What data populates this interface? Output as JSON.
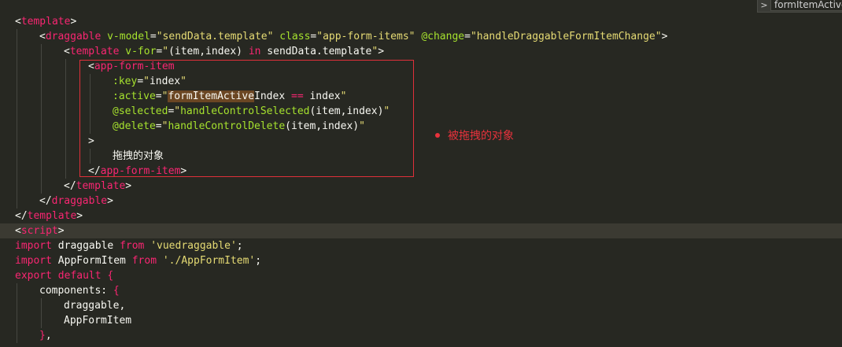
{
  "editor": {
    "theme_colors": {
      "background": "#272822",
      "tag": "#f92672",
      "attribute": "#a6e22e",
      "string": "#e6db74",
      "text": "#f8f8f2",
      "highlight_box": "#e0303a"
    },
    "lines": [
      {
        "indent": 0,
        "tokens": [
          [
            "t-punc",
            "<"
          ],
          [
            "t-tag",
            "template"
          ],
          [
            "t-punc",
            ">"
          ]
        ]
      },
      {
        "indent": 1,
        "tokens": [
          [
            "t-punc",
            "<"
          ],
          [
            "t-tag",
            "draggable"
          ],
          [
            "t-punc",
            " "
          ],
          [
            "t-attr",
            "v-model"
          ],
          [
            "t-punc",
            "="
          ],
          [
            "t-str",
            "\"sendData.template\""
          ],
          [
            "t-punc",
            " "
          ],
          [
            "t-attr",
            "class"
          ],
          [
            "t-punc",
            "="
          ],
          [
            "t-str",
            "\"app-form-items\""
          ],
          [
            "t-punc",
            " "
          ],
          [
            "t-attr",
            "@change"
          ],
          [
            "t-punc",
            "="
          ],
          [
            "t-str",
            "\"handleDraggableFormItemChange\""
          ],
          [
            "t-punc",
            ">"
          ]
        ]
      },
      {
        "indent": 2,
        "tokens": [
          [
            "t-punc",
            "<"
          ],
          [
            "t-tag",
            "template"
          ],
          [
            "t-punc",
            " "
          ],
          [
            "t-attr",
            "v-for"
          ],
          [
            "t-punc",
            "="
          ],
          [
            "t-str",
            "\""
          ],
          [
            "t-name",
            "(item,index) "
          ],
          [
            "t-kw",
            "in"
          ],
          [
            "t-name",
            " sendData.template"
          ],
          [
            "t-str",
            "\""
          ],
          [
            "t-punc",
            ">"
          ]
        ]
      },
      {
        "indent": 3,
        "tokens": [
          [
            "t-punc",
            "<"
          ],
          [
            "t-tag",
            "app-form-item"
          ]
        ]
      },
      {
        "indent": 4,
        "tokens": [
          [
            "t-attr",
            ":key"
          ],
          [
            "t-punc",
            "="
          ],
          [
            "t-str",
            "\""
          ],
          [
            "t-name",
            "index"
          ],
          [
            "t-str",
            "\""
          ]
        ]
      },
      {
        "indent": 4,
        "tokens": [
          [
            "t-attr",
            ":active"
          ],
          [
            "t-punc",
            "="
          ],
          [
            "t-str",
            "\""
          ],
          [
            "t-match",
            "formItemActive"
          ],
          [
            "t-name",
            "Index "
          ],
          [
            "t-op",
            "=="
          ],
          [
            "t-name",
            " index"
          ],
          [
            "t-str",
            "\""
          ]
        ]
      },
      {
        "indent": 4,
        "tokens": [
          [
            "t-attr",
            "@selected"
          ],
          [
            "t-punc",
            "="
          ],
          [
            "t-str",
            "\""
          ],
          [
            "t-attr",
            "handleControlSelected"
          ],
          [
            "t-name",
            "(item,index)"
          ],
          [
            "t-str",
            "\""
          ]
        ]
      },
      {
        "indent": 4,
        "tokens": [
          [
            "t-attr",
            "@delete"
          ],
          [
            "t-punc",
            "="
          ],
          [
            "t-str",
            "\""
          ],
          [
            "t-attr",
            "handleControlDelete"
          ],
          [
            "t-name",
            "(item,index)"
          ],
          [
            "t-str",
            "\""
          ]
        ]
      },
      {
        "indent": 3,
        "tokens": [
          [
            "t-punc",
            ">"
          ]
        ]
      },
      {
        "indent": 4,
        "tokens": [
          [
            "t-text",
            "拖拽的对象"
          ]
        ]
      },
      {
        "indent": 3,
        "tokens": [
          [
            "t-punc",
            "</"
          ],
          [
            "t-tag",
            "app-form-item"
          ],
          [
            "t-punc",
            ">"
          ]
        ]
      },
      {
        "indent": 2,
        "tokens": [
          [
            "t-punc",
            "</"
          ],
          [
            "t-tag",
            "template"
          ],
          [
            "t-punc",
            ">"
          ]
        ]
      },
      {
        "indent": 1,
        "tokens": [
          [
            "t-punc",
            "</"
          ],
          [
            "t-tag",
            "draggable"
          ],
          [
            "t-punc",
            ">"
          ]
        ]
      },
      {
        "indent": 0,
        "tokens": [
          [
            "t-punc",
            "</"
          ],
          [
            "t-tag",
            "template"
          ],
          [
            "t-punc",
            ">"
          ]
        ]
      },
      {
        "indent": 0,
        "highlight": true,
        "tokens": [
          [
            "t-punc",
            "<"
          ],
          [
            "t-tag",
            "script"
          ],
          [
            "t-punc",
            ">"
          ]
        ]
      },
      {
        "indent": 0,
        "tokens": [
          [
            "t-kw",
            "import"
          ],
          [
            "t-name",
            " draggable "
          ],
          [
            "t-kw",
            "from"
          ],
          [
            "t-name",
            " "
          ],
          [
            "t-str",
            "'vuedraggable'"
          ],
          [
            "t-name",
            ";"
          ]
        ]
      },
      {
        "indent": 0,
        "tokens": [
          [
            "t-kw",
            "import"
          ],
          [
            "t-name",
            " AppFormItem "
          ],
          [
            "t-kw",
            "from"
          ],
          [
            "t-name",
            " "
          ],
          [
            "t-str",
            "'./AppFormItem'"
          ],
          [
            "t-name",
            ";"
          ]
        ]
      },
      {
        "indent": 0,
        "tokens": [
          [
            "t-kw",
            "export"
          ],
          [
            "t-name",
            " "
          ],
          [
            "t-kw",
            "default"
          ],
          [
            "t-name",
            " "
          ],
          [
            "t-brace",
            "{"
          ]
        ]
      },
      {
        "indent": 1,
        "tokens": [
          [
            "t-name",
            "components: "
          ],
          [
            "t-brace",
            "{"
          ]
        ]
      },
      {
        "indent": 2,
        "tokens": [
          [
            "t-name",
            "draggable,"
          ]
        ]
      },
      {
        "indent": 2,
        "tokens": [
          [
            "t-name",
            "AppFormItem"
          ]
        ]
      },
      {
        "indent": 1,
        "tokens": [
          [
            "t-brace",
            "}"
          ],
          [
            "t-name",
            ","
          ]
        ]
      }
    ]
  },
  "annotation": {
    "text": "被拖拽的对象"
  },
  "find_widget": {
    "chevron": ">",
    "value": "formItemActive"
  }
}
